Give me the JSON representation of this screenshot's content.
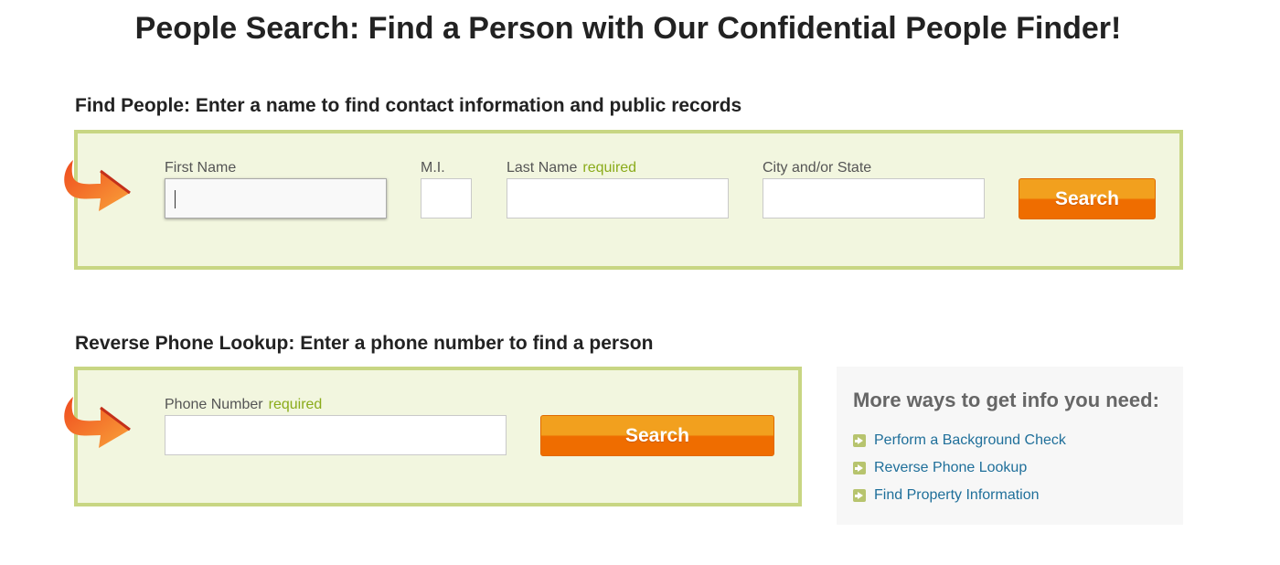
{
  "page": {
    "title": "People Search: Find a Person with Our Confidential People Finder!"
  },
  "find_people": {
    "heading": "Find People: Enter a name to find contact information and public records",
    "fields": {
      "first_name": {
        "label": "First Name",
        "value": ""
      },
      "middle_initial": {
        "label": "M.I.",
        "value": ""
      },
      "last_name": {
        "label": "Last Name",
        "required": "required",
        "value": ""
      },
      "city_state": {
        "label": "City and/or State",
        "value": ""
      }
    },
    "search_label": "Search"
  },
  "phone_lookup": {
    "heading": "Reverse Phone Lookup: Enter a phone number to find a person",
    "fields": {
      "phone": {
        "label": "Phone Number",
        "required": "required",
        "value": ""
      }
    },
    "search_label": "Search"
  },
  "more_ways": {
    "title": "More ways to get info you need:",
    "links": [
      {
        "label": "Perform a Background Check",
        "icon": "arrow-right-bullet-icon"
      },
      {
        "label": "Reverse Phone Lookup",
        "icon": "arrow-right-bullet-icon"
      },
      {
        "label": "Find Property Information",
        "icon": "arrow-right-bullet-icon"
      }
    ]
  },
  "colors": {
    "panel_bg": "#f2f6df",
    "panel_border": "#c8d683",
    "required": "#8aab1a",
    "button_top": "#f2a01e",
    "button_bottom": "#ef6d00",
    "link": "#1f6f9a"
  }
}
